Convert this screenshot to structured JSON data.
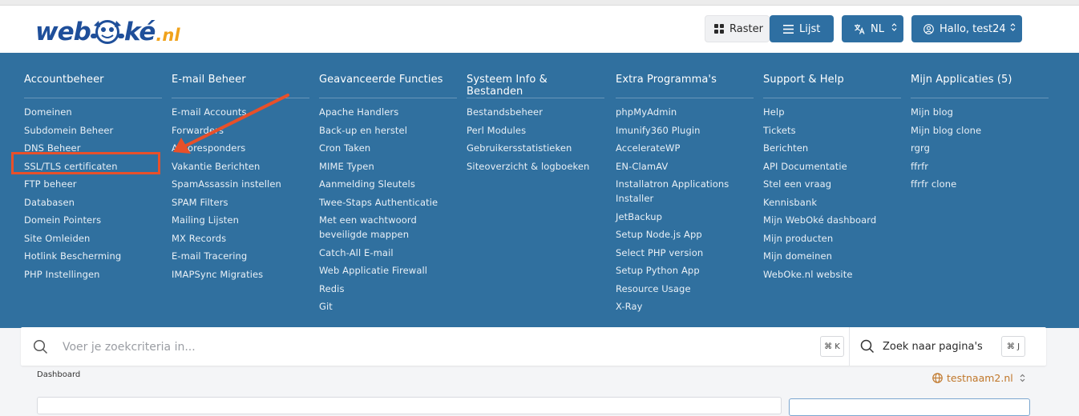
{
  "brand": {
    "logo_text": "webOké.nl",
    "logo_web": "web",
    "logo_oke": "ké",
    "logo_tld": ".nl"
  },
  "header": {
    "raster_label": "Raster",
    "lijst_label": "Lijst",
    "language_label": "NL",
    "user_label": "Hallo, test24"
  },
  "menu": {
    "columns": [
      {
        "title": "Accountbeheer",
        "items": [
          "Domeinen",
          "Subdomein Beheer",
          "DNS Beheer",
          "SSL/TLS certificaten",
          "FTP beheer",
          "Databasen",
          "Domein Pointers",
          "Site Omleiden",
          "Hotlink Bescherming",
          "PHP Instellingen"
        ]
      },
      {
        "title": "E-mail Beheer",
        "items": [
          "E-mail Accounts",
          "Forwarders",
          "Autoresponders",
          "Vakantie Berichten",
          "SpamAssassin instellen",
          "SPAM Filters",
          "Mailing Lijsten",
          "MX Records",
          "E-mail Tracering",
          "IMAPSync Migraties"
        ]
      },
      {
        "title": "Geavanceerde Functies",
        "items": [
          "Apache Handlers",
          "Back-up en herstel",
          "Cron Taken",
          "MIME Typen",
          "Aanmelding Sleutels",
          "Twee-Staps Authenticatie",
          "Met een wachtwoord beveiligde mappen",
          "Catch-All E-mail",
          "Web Applicatie Firewall",
          "Redis",
          "Git"
        ]
      },
      {
        "title": "Systeem Info & Bestanden",
        "items": [
          "Bestandsbeheer",
          "Perl Modules",
          "Gebruikersstatistieken",
          "Siteoverzicht & logboeken"
        ]
      },
      {
        "title": "Extra Programma's",
        "items": [
          "phpMyAdmin",
          "Imunify360 Plugin",
          "AccelerateWP",
          "EN-ClamAV",
          "Installatron Applications Installer",
          "JetBackup",
          "Setup Node.js App",
          "Select PHP version",
          "Setup Python App",
          "Resource Usage",
          "X-Ray"
        ]
      },
      {
        "title": "Support & Help",
        "items": [
          "Help",
          "Tickets",
          "Berichten",
          "API Documentatie",
          "Stel een vraag",
          "Kennisbank",
          "Mijn WebOké dashboard",
          "Mijn producten",
          "Mijn domeinen",
          "WebOke.nl website"
        ]
      },
      {
        "title": "Mijn Applicaties (5)",
        "items": [
          "Mijn blog",
          "Mijn blog clone",
          "rgrg",
          "ffrfr",
          "ffrfr clone"
        ]
      }
    ]
  },
  "annotation": {
    "highlighted_item": "SSL/TLS certificaten",
    "color": "#e8502a"
  },
  "search": {
    "placeholder": "Voer je zoekcriteria in...",
    "shortcut": "⌘ K",
    "page_search_label": "Zoek naar pagina's",
    "page_search_shortcut": "⌘ J"
  },
  "breadcrumb": {
    "label": "Dashboard"
  },
  "domain_selector": {
    "value": "testnaam2.nl"
  },
  "colors": {
    "menu_bg": "#30709f",
    "accent": "#2e6fa2",
    "domain": "#c0772a"
  }
}
